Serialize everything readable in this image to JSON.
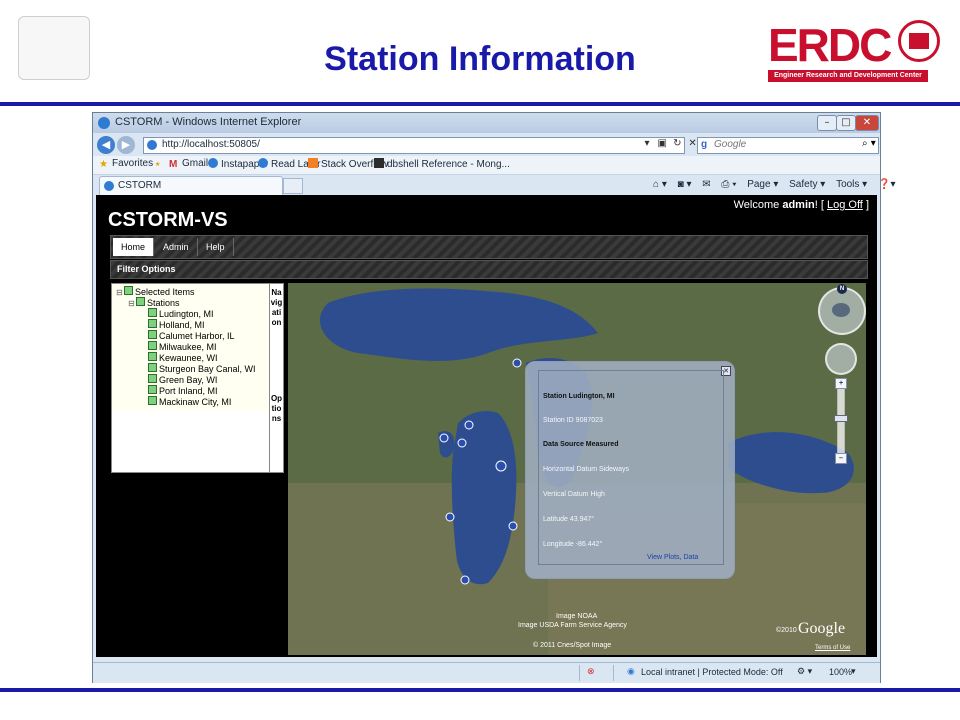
{
  "slide": {
    "title": "Station Information",
    "logo_text": "ERDC",
    "logo_subtitle": "Engineer Research and Development Center"
  },
  "browser": {
    "title": "CSTORM - Windows Internet Explorer",
    "url": "http://localhost:50805/",
    "search_placeholder": "Google",
    "tab_label": "CSTORM",
    "favorites_label": "Favorites",
    "favorites": [
      "Gmail",
      "Instapaper",
      "Read Later",
      "Stack Overflow",
      "dbshell Reference - Mong..."
    ],
    "commands": [
      "Page ▾",
      "Safety ▾",
      "Tools ▾"
    ],
    "status": {
      "zone": "Local intranet | Protected Mode: Off",
      "zoom": "100%"
    }
  },
  "app": {
    "title": "CSTORM-VS",
    "welcome_prefix": "Welcome",
    "user": "admin",
    "welcome_suffix": "! [",
    "logoff": "Log Off",
    "welcome_close": "]",
    "menu": [
      "Home",
      "Admin",
      "Help"
    ],
    "filter_label": "Filter Options"
  },
  "tree": {
    "root": "Selected Items",
    "group": "Stations",
    "stations": [
      "Ludington, MI",
      "Holland, MI",
      "Calumet Harbor, IL",
      "Milwaukee, MI",
      "Kewaunee, WI",
      "Sturgeon Bay Canal, WI",
      "Green Bay, WI",
      "Port Inland, MI",
      "Mackinaw City, MI"
    ],
    "nav_label_1": "Navigation",
    "nav_label_2": "Options"
  },
  "popup": {
    "station": "Station Ludington, MI",
    "station_id": "Station ID 9087023",
    "data_source": "Data Source Measured",
    "horizontal_datum": "Horizontal Datum Sideways",
    "vertical_datum": "Vertical Datum High",
    "latitude": "Latitude 43.947°",
    "longitude": "Longitude -86.442°",
    "link": "View Plots, Data"
  },
  "map": {
    "attribution_1": "Image NOAA",
    "attribution_2": "Image USDA Farm Service Agency",
    "attribution_3": "© 2011 Cnes/Spot Image",
    "copyright_year": "©2010",
    "brand": "Google",
    "terms": "Terms of Use"
  },
  "colors": {
    "title_blue": "#1a1aa8",
    "erdc_red": "#c8102e",
    "lake_blue": "#2d4d8e",
    "land_green": "#5a6a44"
  }
}
